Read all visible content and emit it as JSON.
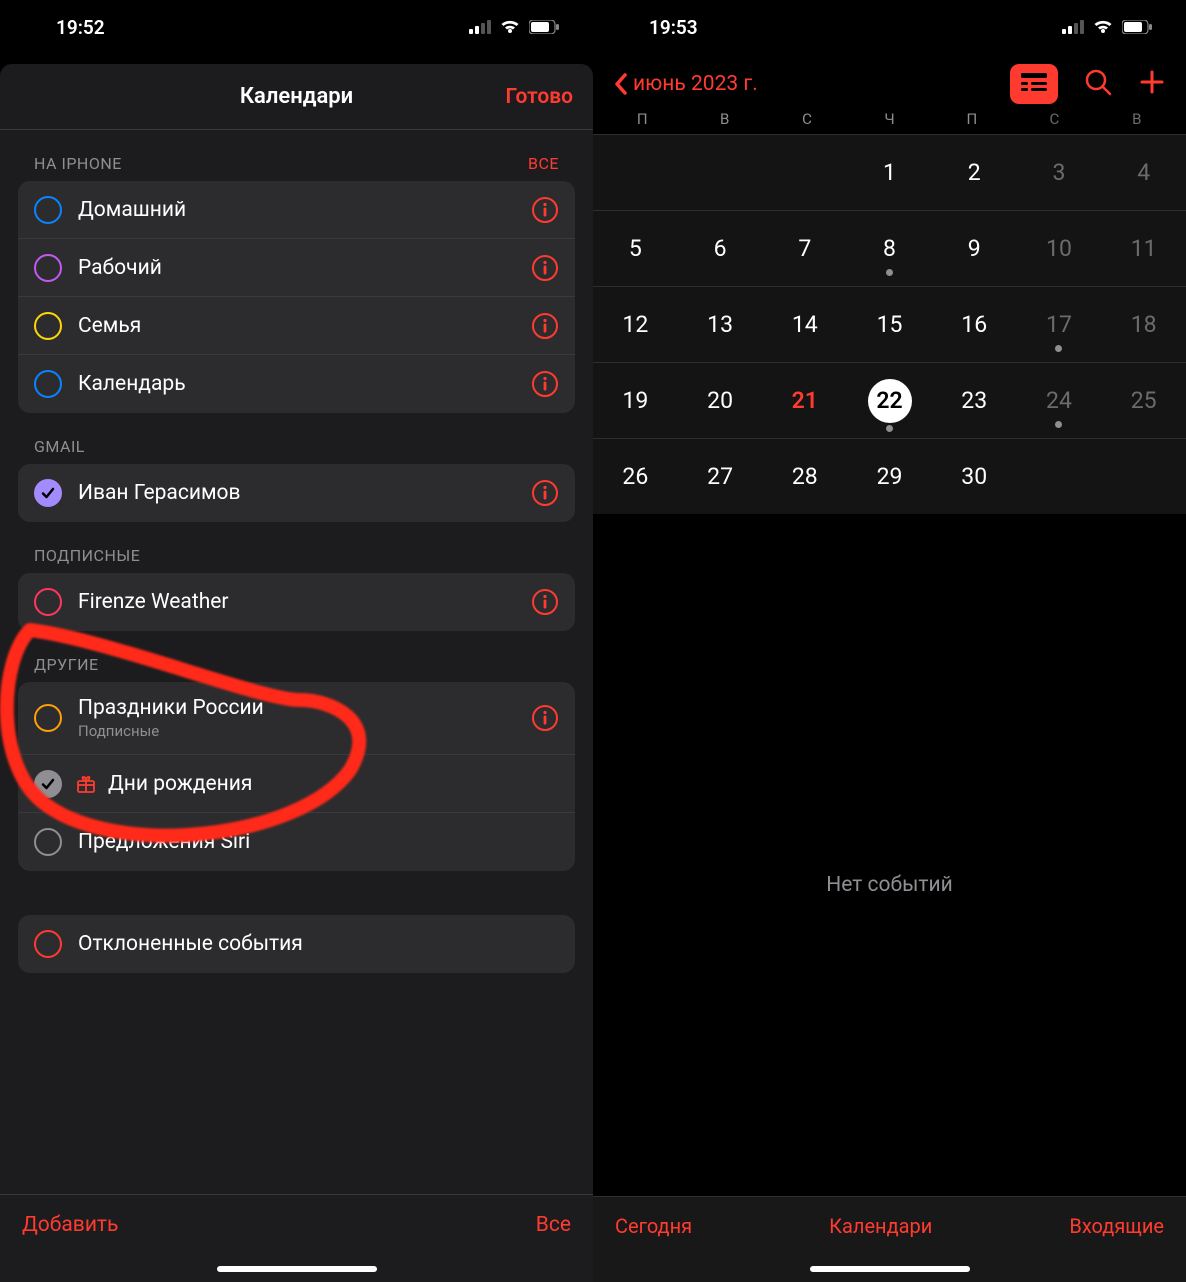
{
  "left": {
    "status_time": "19:52",
    "sheet_title": "Календари",
    "done": "Готово",
    "sections": [
      {
        "header": "НА IPHONE",
        "all": "ВСЕ",
        "items": [
          {
            "label": "Домашний",
            "color": "#0a84ff",
            "checked": false,
            "info": true
          },
          {
            "label": "Рабочий",
            "color": "#bf5af2",
            "checked": false,
            "info": true
          },
          {
            "label": "Семья",
            "color": "#ffd60a",
            "checked": false,
            "info": true
          },
          {
            "label": "Календарь",
            "color": "#0a84ff",
            "checked": false,
            "info": true
          }
        ]
      },
      {
        "header": "GMAIL",
        "items": [
          {
            "label": "Иван Герасимов",
            "filled": true,
            "checked": true,
            "info": true
          }
        ]
      },
      {
        "header": "ПОДПИСНЫЕ",
        "items": [
          {
            "label": "Firenze Weather",
            "color": "#ff375f",
            "checked": false,
            "info": true
          }
        ]
      },
      {
        "header": "ДРУГИЕ",
        "items": [
          {
            "label": "Праздники России",
            "sublabel": "Подписные",
            "color": "#ff9f0a",
            "checked": false,
            "info": true
          },
          {
            "label": "Дни рождения",
            "filled_grey": true,
            "checked": true,
            "gift": true
          },
          {
            "label": "Предложения Siri",
            "color": "#8e8e93",
            "checked": false
          }
        ]
      },
      {
        "items": [
          {
            "label": "Отклоненные события",
            "color": "#ff3b30",
            "checked": false
          }
        ]
      }
    ],
    "footer_left": "Добавить",
    "footer_right": "Все"
  },
  "right": {
    "status_time": "19:53",
    "month_label": "июнь 2023 г.",
    "weekdays": [
      "П",
      "В",
      "С",
      "Ч",
      "П",
      "С",
      "В"
    ],
    "weeks": [
      [
        {
          "n": ""
        },
        {
          "n": ""
        },
        {
          "n": ""
        },
        {
          "n": "1"
        },
        {
          "n": "2"
        },
        {
          "n": "3",
          "weekend": true
        },
        {
          "n": "4",
          "weekend": true
        }
      ],
      [
        {
          "n": "5"
        },
        {
          "n": "6"
        },
        {
          "n": "7"
        },
        {
          "n": "8",
          "dot": true
        },
        {
          "n": "9"
        },
        {
          "n": "10",
          "weekend": true
        },
        {
          "n": "11",
          "weekend": true
        }
      ],
      [
        {
          "n": "12"
        },
        {
          "n": "13"
        },
        {
          "n": "14"
        },
        {
          "n": "15"
        },
        {
          "n": "16"
        },
        {
          "n": "17",
          "weekend": true,
          "dot": true
        },
        {
          "n": "18",
          "weekend": true
        }
      ],
      [
        {
          "n": "19"
        },
        {
          "n": "20"
        },
        {
          "n": "21",
          "red": true
        },
        {
          "n": "22",
          "selected": true,
          "dot": true
        },
        {
          "n": "23"
        },
        {
          "n": "24",
          "weekend": true,
          "dot": true
        },
        {
          "n": "25",
          "weekend": true
        }
      ],
      [
        {
          "n": "26"
        },
        {
          "n": "27"
        },
        {
          "n": "28"
        },
        {
          "n": "29"
        },
        {
          "n": "30"
        },
        {
          "n": "",
          "weekend": true
        },
        {
          "n": "",
          "weekend": true
        }
      ]
    ],
    "no_events": "Нет событий",
    "toolbar": {
      "today": "Сегодня",
      "calendars": "Календари",
      "inbox": "Входящие"
    }
  }
}
